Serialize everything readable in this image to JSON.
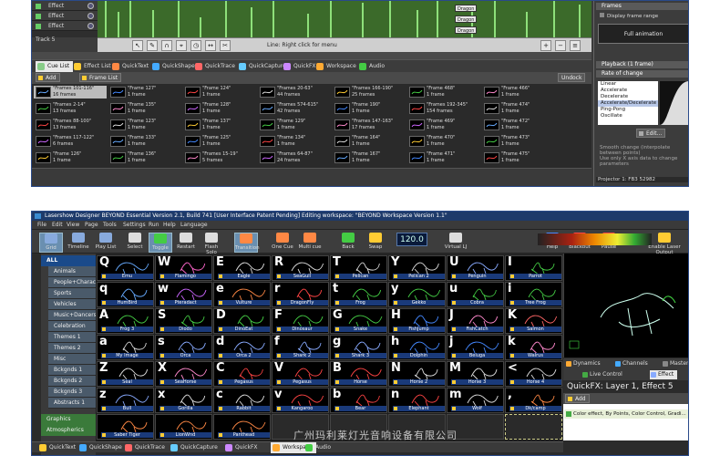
{
  "top": {
    "tracks": [
      {
        "label": "Effect"
      },
      {
        "label": "Effect"
      },
      {
        "label": "Effect"
      }
    ],
    "track5_label": "Track 5",
    "clips": [
      "Dragon",
      "Dragon",
      "Dragon"
    ],
    "timeline_hint": "Line: Right click for menu",
    "tabs": [
      "Cue List",
      "Effect List",
      "QuickText",
      "QuickShape",
      "QuickTrace",
      "QuickCapture",
      "QuickFX",
      "Workspace",
      "Audio"
    ],
    "add_label": "Add",
    "frame_list_label": "Frame List",
    "undock_label": "Undock",
    "cues": [
      {
        "name": "\"Frames 101-116\"",
        "sub": "16 frames",
        "selected": true
      },
      {
        "name": "\"Frames 2-14\"",
        "sub": "13 frames"
      },
      {
        "name": "\"Frames 88-100\"",
        "sub": "13 frames"
      },
      {
        "name": "\"Frames 117-122\"",
        "sub": "6 frames"
      },
      {
        "name": "\"Frame 126\"",
        "sub": "1 frame"
      },
      {
        "name": "\"Frame 127\"",
        "sub": "1 frame"
      },
      {
        "name": "\"Frame 135\"",
        "sub": "1 frame"
      },
      {
        "name": "\"Frame 123\"",
        "sub": "1 frame"
      },
      {
        "name": "\"Frame 133\"",
        "sub": "1 frame"
      },
      {
        "name": "\"Frame 136\"",
        "sub": "1 frame"
      },
      {
        "name": "\"Frame 124\"",
        "sub": "1 frame"
      },
      {
        "name": "\"Frame 128\"",
        "sub": "1 frame"
      },
      {
        "name": "\"Frame 137\"",
        "sub": "1 frame"
      },
      {
        "name": "\"Frame 125\"",
        "sub": "1 frame"
      },
      {
        "name": "\"Frames 15-19\"",
        "sub": "5 frames"
      },
      {
        "name": "\"Frames 20-63\"",
        "sub": "44 frames"
      },
      {
        "name": "\"Frames 574-615\"",
        "sub": "42 frames"
      },
      {
        "name": "\"Frame 129\"",
        "sub": "1 frame"
      },
      {
        "name": "\"Frame 134\"",
        "sub": "1 frame"
      },
      {
        "name": "\"Frames 64-87\"",
        "sub": "24 frames"
      },
      {
        "name": "\"Frames 166-190\"",
        "sub": "25 frames"
      },
      {
        "name": "\"Frame 190\"",
        "sub": "1 frame"
      },
      {
        "name": "\"Frames 147-163\"",
        "sub": "17 frames"
      },
      {
        "name": "\"Frame 164\"",
        "sub": "1 frame"
      },
      {
        "name": "\"Frame 167\"",
        "sub": "1 frame"
      },
      {
        "name": "\"Frame 468\"",
        "sub": "1 frame"
      },
      {
        "name": "\"Frames 192-345\"",
        "sub": "154 frames"
      },
      {
        "name": "\"Frame 469\"",
        "sub": "1 frame"
      },
      {
        "name": "\"Frame 470\"",
        "sub": "1 frame"
      },
      {
        "name": "\"Frame 471\"",
        "sub": "1 frame"
      },
      {
        "name": "\"Frame 466\"",
        "sub": "1 frame"
      },
      {
        "name": "\"Frame 474\"",
        "sub": "1 frame"
      },
      {
        "name": "\"Frame 472\"",
        "sub": "1 frame"
      },
      {
        "name": "\"Frame 473\"",
        "sub": "1 frame"
      },
      {
        "name": "\"Frame 475\"",
        "sub": "1 frame"
      }
    ],
    "right_panel": {
      "frames_header": "Frames",
      "display_frame_range": "Display frame range",
      "full_animation": "Full animation",
      "playback_header": "Playback (1 frame)",
      "rate_header": "Rate of change",
      "rates": [
        "Linear",
        "Accelerate",
        "Decelerate",
        "Accelerate/Decelerate",
        "Ping-Pong",
        "Oscillate"
      ],
      "selected_rate": "Accelerate/Decelerate",
      "edit_label": "Edit...",
      "smooth_change": "Smooth change (interpolate between points)",
      "use_only_x": "Use only X axis data to change parameters",
      "projector": "Projector 1: FB3 52982"
    }
  },
  "bottom": {
    "title": "Lasershow Designer BEYOND Essential  Version 2.1, Build 741  [User Interface Patent Pending]  Editing workspace: \"BEYOND Workspace Version 1.1\"",
    "menu": [
      "File",
      "Edit",
      "View",
      "Page",
      "Tools",
      "Settings",
      "Run",
      "Help",
      "Language"
    ],
    "toolbar": [
      "Grid",
      "Timeline",
      "Play List",
      "Select",
      "Toggle",
      "Restart",
      "Flash Solo",
      "Transition",
      "One Cue",
      "Multi cue",
      "Back",
      "Swap",
      "Virtual LJ",
      "Help",
      "Blackout",
      "Pause",
      "Enable Laser Output"
    ],
    "bpm": "120.0",
    "categories": [
      {
        "label": "ALL",
        "type": "all"
      },
      {
        "label": "Animals",
        "type": "sub"
      },
      {
        "label": "People+Characters",
        "type": "sub"
      },
      {
        "label": "Sports",
        "type": "sub"
      },
      {
        "label": "Vehicles",
        "type": "sub"
      },
      {
        "label": "Music+Dancers",
        "type": "sub"
      },
      {
        "label": "Celebration",
        "type": "sub"
      },
      {
        "label": "Themes 1",
        "type": "sub"
      },
      {
        "label": "Themes 2",
        "type": "sub"
      },
      {
        "label": "Misc",
        "type": "sub"
      },
      {
        "label": "Bckgnds 1",
        "type": "sub"
      },
      {
        "label": "Bckgnds 2",
        "type": "sub"
      },
      {
        "label": "Bckgnds 3",
        "type": "sub"
      },
      {
        "label": "Abstracts 1",
        "type": "sub"
      },
      {
        "label": "Graphics",
        "type": "green"
      },
      {
        "label": "Atmospherics",
        "type": "green"
      }
    ],
    "grid": [
      {
        "letter": "Q",
        "name": "Emu",
        "color": "#6af"
      },
      {
        "letter": "W",
        "name": "Flamingo",
        "color": "#f6c"
      },
      {
        "letter": "E",
        "name": "Eagle",
        "color": "#ddd"
      },
      {
        "letter": "R",
        "name": "SeaGull",
        "color": "#ddd"
      },
      {
        "letter": "T",
        "name": "Pelican",
        "color": "#ddd"
      },
      {
        "letter": "Y",
        "name": "Pelican 2",
        "color": "#ddd"
      },
      {
        "letter": "U",
        "name": "Penguin",
        "color": "#8af"
      },
      {
        "letter": "I",
        "name": "Parrot",
        "color": "#4c4"
      },
      {
        "letter": "q",
        "name": "HumBird",
        "color": "#6af"
      },
      {
        "letter": "w",
        "name": "Pteradact",
        "color": "#c6f"
      },
      {
        "letter": "e",
        "name": "Vulture",
        "color": "#f84"
      },
      {
        "letter": "r",
        "name": "DragonFly",
        "color": "#f44"
      },
      {
        "letter": "t",
        "name": "Frog",
        "color": "#4c4"
      },
      {
        "letter": "y",
        "name": "Gekko",
        "color": "#4c4"
      },
      {
        "letter": "u",
        "name": "Cobra",
        "color": "#4c4"
      },
      {
        "letter": "i",
        "name": "Tree Frog",
        "color": "#4c4"
      },
      {
        "letter": "A",
        "name": "Frog 3",
        "color": "#4c4"
      },
      {
        "letter": "S",
        "name": "Diodo",
        "color": "#4c4"
      },
      {
        "letter": "D",
        "name": "DinoEat",
        "color": "#4c4"
      },
      {
        "letter": "F",
        "name": "Dinosaur",
        "color": "#4c4"
      },
      {
        "letter": "G",
        "name": "Snake",
        "color": "#4c4"
      },
      {
        "letter": "H",
        "name": "FishJump",
        "color": "#48f"
      },
      {
        "letter": "J",
        "name": "FishCatch",
        "color": "#f8c"
      },
      {
        "letter": "K",
        "name": "Salmon",
        "color": "#f66"
      },
      {
        "letter": "a",
        "name": "My Image",
        "color": "#ddd"
      },
      {
        "letter": "s",
        "name": "Orca",
        "color": "#8af"
      },
      {
        "letter": "d",
        "name": "Orca 2",
        "color": "#8af"
      },
      {
        "letter": "f",
        "name": "Shark 2",
        "color": "#8af"
      },
      {
        "letter": "g",
        "name": "Shark 3",
        "color": "#8af"
      },
      {
        "letter": "h",
        "name": "Dolphin",
        "color": "#48f"
      },
      {
        "letter": "j",
        "name": "Beluga",
        "color": "#48f"
      },
      {
        "letter": "k",
        "name": "Walrus",
        "color": "#f8c"
      },
      {
        "letter": "Z",
        "name": "Seal",
        "color": "#ddd"
      },
      {
        "letter": "X",
        "name": "SeaHorse",
        "color": "#f8c"
      },
      {
        "letter": "C",
        "name": "Pegasus",
        "color": "#f44"
      },
      {
        "letter": "V",
        "name": "Pegasus",
        "color": "#f44"
      },
      {
        "letter": "B",
        "name": "Horse",
        "color": "#f44"
      },
      {
        "letter": "N",
        "name": "Horse 2",
        "color": "#ddd"
      },
      {
        "letter": "M",
        "name": "Horse 3",
        "color": "#ddd"
      },
      {
        "letter": "<",
        "name": "Horse 4",
        "color": "#ddd"
      },
      {
        "letter": "z",
        "name": "Bull",
        "color": "#8af"
      },
      {
        "letter": "x",
        "name": "Gorilla",
        "color": "#ddd"
      },
      {
        "letter": "c",
        "name": "Rabbit",
        "color": "#ddd"
      },
      {
        "letter": "v",
        "name": "Kangaroo",
        "color": "#f44"
      },
      {
        "letter": "b",
        "name": "Bear",
        "color": "#f44"
      },
      {
        "letter": "n",
        "name": "Elephant",
        "color": "#f44"
      },
      {
        "letter": "m",
        "name": "Wolf",
        "color": "#ddd"
      },
      {
        "letter": ",",
        "name": "Dk/camp",
        "color": "#f84"
      },
      {
        "letter": "",
        "name": "Saber Tiger",
        "color": "#f84"
      },
      {
        "letter": "",
        "name": "LionWnd",
        "color": "#f84"
      },
      {
        "letter": "",
        "name": "Panthead",
        "color": "#f84"
      }
    ],
    "right_tabs": [
      "Dynamics",
      "Channels",
      "Master"
    ],
    "right_tabs2": [
      "Live Control",
      "Effect"
    ],
    "quickfx_title": "QuickFX: Layer 1, Effect 5",
    "quickfx_add": "Add",
    "quickfx_item": "Color effect, By Points, Color Control, Gradi...",
    "bottom_tabs": [
      "QuickText",
      "QuickShape",
      "QuickTrace",
      "QuickCapture",
      "QuickFX",
      "Workspace",
      "Audio"
    ]
  },
  "watermark": "广州玛利莱灯光音响设备有限公司",
  "colors": {
    "accent_blue": "#1a3a7a",
    "timeline_green": "#3b6a2a",
    "selection_gray": "#bcbcbc"
  }
}
